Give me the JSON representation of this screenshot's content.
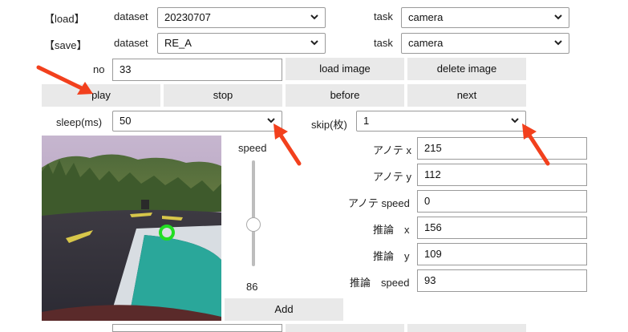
{
  "load": {
    "section_label": "【load】",
    "dataset_label": "dataset",
    "dataset_value": "20230707",
    "task_label": "task",
    "task_value": "camera"
  },
  "save": {
    "section_label": "【save】",
    "dataset_label": "dataset",
    "dataset_value": "RE_A",
    "task_label": "task",
    "task_value": "camera"
  },
  "controls": {
    "no_label": "no",
    "no_value": "33",
    "load_image": "load image",
    "delete_image": "delete image",
    "play": "play",
    "stop": "stop",
    "before": "before",
    "next": "next",
    "sleep_label": "sleep(ms)",
    "sleep_value": "50",
    "skip_label": "skip(枚)",
    "skip_value": "1"
  },
  "slider": {
    "label": "speed",
    "value": "86",
    "level": 0.43,
    "add_label": "Add"
  },
  "annotation": {
    "x_label": "アノテ x",
    "x_value": "215",
    "y_label": "アノテ y",
    "y_value": "112",
    "speed_label": "アノテ speed",
    "speed_value": "0"
  },
  "inference": {
    "x_label": "推論　x",
    "x_value": "156",
    "y_label": "推論　y",
    "y_value": "109",
    "speed_label": "推論　speed",
    "speed_value": "93"
  },
  "colors": {
    "arrow": "#f2401d",
    "button_bg": "#e9e9e9",
    "marker": "#22dd22"
  }
}
